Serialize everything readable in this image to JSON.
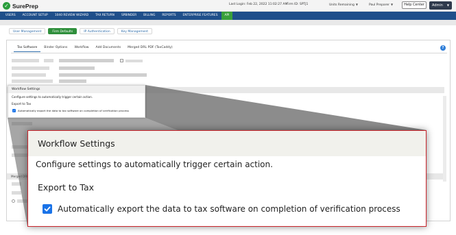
{
  "header": {
    "logo_text": "SurePrep",
    "last_login": "Last Login: Feb 22, 2022 11:02:27 AM",
    "firm_id": "Firm ID: SPTJ1",
    "units_remaining": "Units Remaining",
    "user_name": "Paul Preparer",
    "help_center": "Help Center",
    "admin": "Admin"
  },
  "nav": {
    "items": [
      "USERS",
      "ACCOUNT SETUP",
      "1040 REVIEW WIZARD",
      "TAX RETURN",
      "SPBINDER",
      "BILLING",
      "REPORTS",
      "ENTERPRISE FEATURES",
      "API"
    ],
    "active_index": 8
  },
  "subtabs": {
    "items": [
      "User Management",
      "Firm Defaults",
      "IP Authentication",
      "Key Management"
    ],
    "active_index": 1
  },
  "panel": {
    "tabs": [
      "Tax Software",
      "Binder Options",
      "Workflow",
      "Add Documents",
      "Merged DRL PDF (TaxCaddy)"
    ],
    "active_index": 0,
    "merged_label": "Merged DRL"
  },
  "workflow_settings": {
    "title": "Workflow Settings",
    "description": "Configure settings to automatically trigger certain action.",
    "section": "Export to Tax",
    "checkbox_label": "Automatically export the data to tax software on completion of verification process",
    "checked": true
  },
  "colors": {
    "nav_bg": "#1f4f8a",
    "nav_active": "#3aa03b",
    "accent_green": "#2f8f3c",
    "checkbox_blue": "#1a73e8",
    "highlight_border": "#c9242b"
  },
  "icons": {
    "logo": "check-circle-icon",
    "info": "info-icon",
    "checkbox": "checkmark-icon",
    "dropdown": "chevron-down-icon"
  }
}
